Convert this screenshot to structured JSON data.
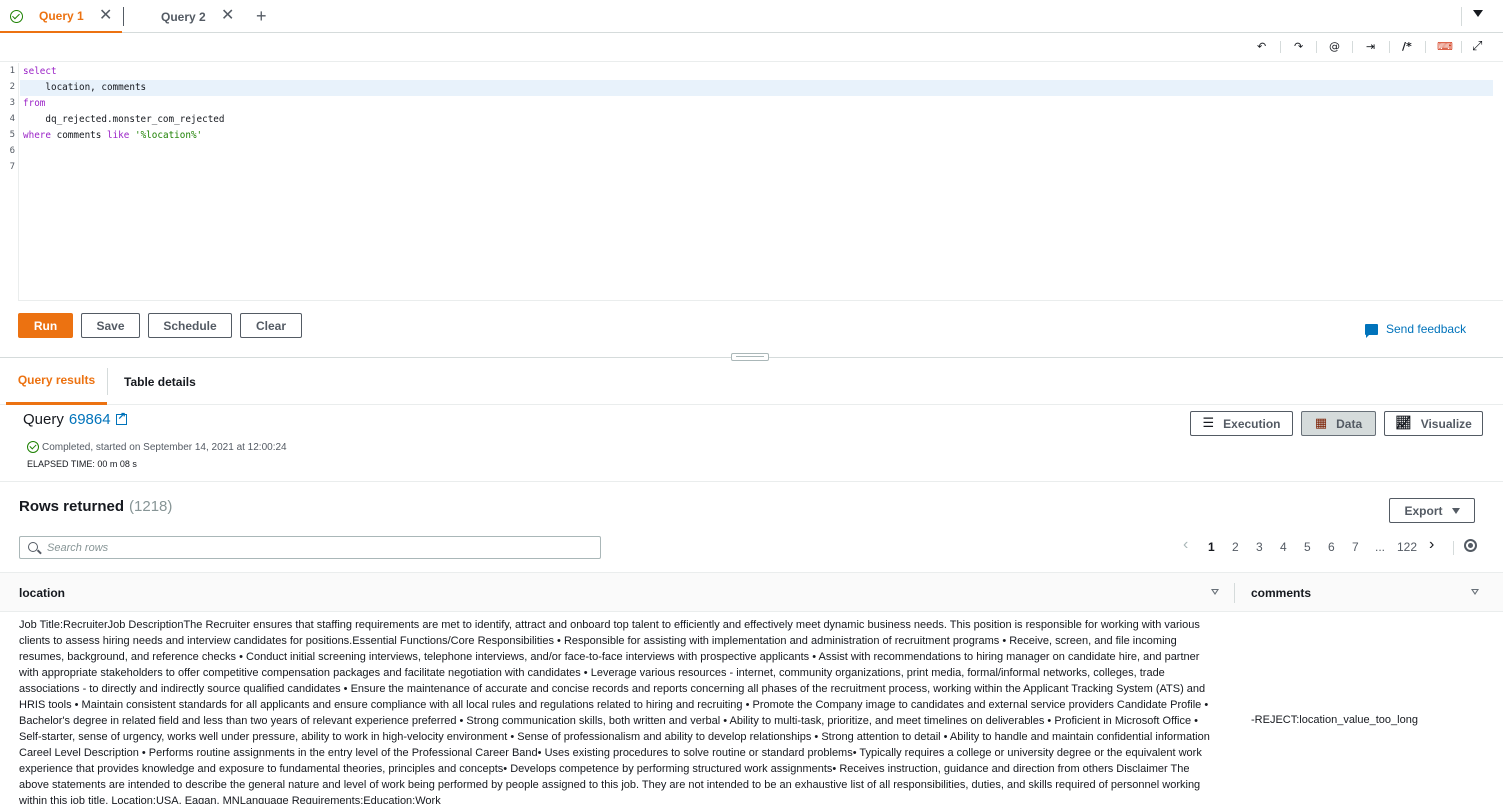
{
  "tabs": [
    {
      "label": "Query 1",
      "status": "completed"
    },
    {
      "label": "Query 2"
    }
  ],
  "add_tab_label": "+",
  "tab_close_glyph": "✕",
  "editor": {
    "toolbar_icons": [
      "undo-icon",
      "redo-icon",
      "at-sign-icon",
      "indent-icon",
      "comment-icon",
      "keyboard-icon",
      "fullscreen-icon"
    ],
    "toolbar_glyphs": {
      "undo": "↶",
      "redo": "↷",
      "at": "@",
      "indent": "⇥",
      "comment": "/*",
      "keyboard": "⌨",
      "fullscreen": "⤢"
    },
    "line_numbers": [
      "1",
      "2",
      "3",
      "4",
      "5",
      "6",
      "7"
    ],
    "code": {
      "l1": "select",
      "l2": "    location, comments",
      "l3": "from",
      "l4": "    dq_rejected.monster_com_rejected",
      "l5_kw1": "where",
      "l5_mid": " comments ",
      "l5_kw2": "like",
      "l5_sp": " ",
      "l5_str": "'%location%'"
    }
  },
  "actions": {
    "run": "Run",
    "save": "Save",
    "schedule": "Schedule",
    "clear": "Clear",
    "feedback": "Send feedback"
  },
  "results_tabs": {
    "query_results": "Query results",
    "table_details": "Table details"
  },
  "query": {
    "title_prefix": "Query",
    "id": "69864",
    "status": "Completed, started on September 14, 2021 at 12:00:24",
    "elapsed": "ELAPSED TIME: 00 m 08 s"
  },
  "view_buttons": {
    "execution": "Execution",
    "data": "Data",
    "visualize": "Visualize"
  },
  "rows": {
    "title": "Rows returned",
    "count": "(1218)",
    "export": "Export",
    "search_placeholder": "Search rows"
  },
  "pagination": {
    "pages": [
      "1",
      "2",
      "3",
      "4",
      "5",
      "6",
      "7"
    ],
    "ellipsis": "...",
    "last": "122",
    "current": "1",
    "prev": "‹",
    "next": "›"
  },
  "table": {
    "columns": [
      "location",
      "comments"
    ],
    "rows": [
      {
        "location": "Job Title:RecruiterJob DescriptionThe Recruiter ensures that staffing requirements are met to identify, attract and onboard top talent to efficiently and effectively meet dynamic business needs. This position is responsible for working with various clients to assess hiring needs and interview candidates for positions.Essential Functions/Core Responsibilities  • Responsible for assisting with implementation and administration of recruitment programs   • Receive, screen, and file incoming resumes, background, and reference checks   • Conduct initial screening interviews, telephone interviews, and/or face-to-face interviews with prospective applicants   • Assist with recommendations to hiring manager on candidate hire, and partner with appropriate stakeholders to offer competitive compensation packages and facilitate negotiation with candidates   • Leverage various resources - internet, community organizations, print media, formal/informal networks, colleges, trade associations - to directly and indirectly source qualified candidates   • Ensure the maintenance of accurate and concise records and reports concerning all phases of the recruitment process, working within the Applicant Tracking System (ATS) and HRIS tools   • Maintain consistent standards for all applicants and ensure compliance with all local rules and regulations related to hiring and recruiting   • Promote the Company image to candidates and external service providers    Candidate Profile  • Bachelor's degree in related field and less than two years of relevant experience preferred   • Strong communication skills, both written and verbal   • Ability to multi-task, prioritize, and meet timelines on deliverables   • Proficient in Microsoft Office   • Self-starter, sense of urgency, works well under pressure, ability to work in high-velocity environment   • Sense of professionalism and ability to develop relationships   • Strong attention to detail   • Ability to handle and maintain confidential information    Careel Level Description  • Performs routine assignments in the entry level of the Professional Career Band• Uses existing procedures to solve routine or standard problems• Typically requires a college or university degree or the equivalent work experience that provides knowledge and exposure to fundamental theories, principles and concepts• Develops competence by performing structured work assignments• Receives instruction, guidance and direction from others    Disclaimer   The above statements are intended to describe the general nature and level of work being performed by people assigned to this job. They are not intended to be an exhaustive list of all responsibilities, duties, and skills required of personnel working within this job title. Location:USA, Eagan, MNLanguage Requirements:Education:Work",
        "comments": "-REJECT:location_value_too_long"
      }
    ]
  },
  "colors": {
    "accent": "#ec7211",
    "link": "#0073bb",
    "success": "#1d8102",
    "keyword": "#9b24c7",
    "string": "#1d8102"
  }
}
